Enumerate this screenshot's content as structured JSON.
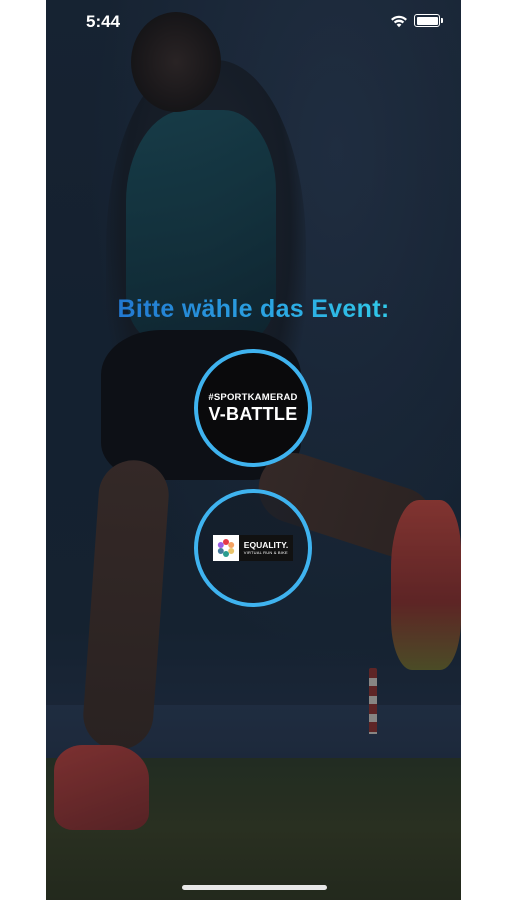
{
  "status_bar": {
    "time": "5:44",
    "wifi_icon": "wifi-icon",
    "battery_icon": "battery-icon"
  },
  "heading": "Bitte wähle das Event:",
  "events": [
    {
      "tag": "#SPORTKAMERAD",
      "title": "V-BATTLE"
    },
    {
      "logo_icon": "equality-flower-icon",
      "title": "EQUALITY.",
      "subtitle": "VIRTUAL RUN & BIKE"
    }
  ],
  "colors": {
    "accent_ring": "#3fb3ef",
    "heading_gradient_start": "#1e63c8",
    "heading_gradient_end": "#35e0ef"
  }
}
